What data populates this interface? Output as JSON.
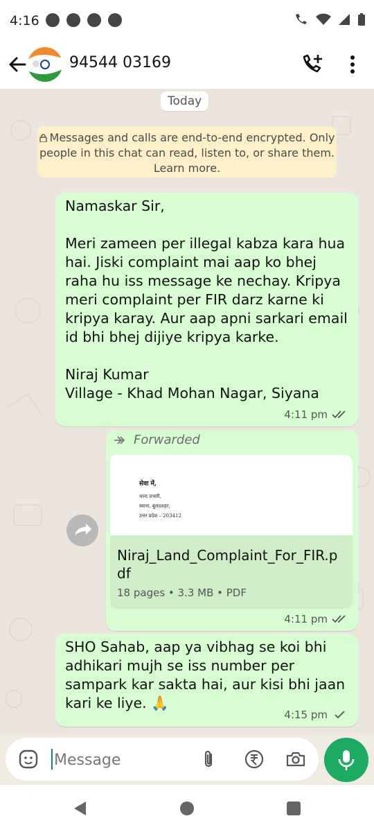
{
  "status": {
    "time": "4:16"
  },
  "header": {
    "contact": "94544 03169"
  },
  "chat": {
    "day_chip": "Today",
    "encryption_notice": "Messages and calls are end-to-end encrypted. Only people in this chat can read, listen to, or share them. Learn more.",
    "messages": [
      {
        "text": "Namaskar Sir,\n\nMeri zameen per illegal kabza kara hua hai. Jiski complaint mai aap ko bhej raha hu iss message ke nechay. Kripya meri complaint per FIR darz karne ki kripya karay. Aur aap apni sarkari email id bhi bhej dijiye kripya karke.\n\nNiraj Kumar\nVillage - Khad Mohan Nagar, Siyana",
        "time": "4:11 pm"
      },
      {
        "forwarded_label": "Forwarded",
        "doc_preview": {
          "heading": "सेवा में,",
          "line1": "थाना प्रभारी,",
          "line2": "स्याना, बुलंदशहर,",
          "line3": "उत्तर प्रदेश – 203412"
        },
        "file_name": "Niraj_Land_Complaint_For_FIR.pdf",
        "file_meta": "18 pages • 3.3 MB • PDF",
        "time": "4:11 pm"
      },
      {
        "text": "SHO Sahab, aap ya vibhag se koi bhi adhikari mujh se iss number per sampark kar sakta hai, aur kisi bhi jaan kari ke liye. 🙏",
        "time": "4:15 pm"
      }
    ]
  },
  "composer": {
    "placeholder": "Message"
  },
  "colors": {
    "accent": "#1daa61",
    "outgoing_bubble": "#d9fdd3",
    "notice_bg": "#fdf0c8"
  },
  "icons": [
    "back-arrow-icon",
    "add-call-icon",
    "more-vert-icon",
    "lock-icon",
    "forward-icon",
    "share-icon",
    "sticker-icon",
    "attach-icon",
    "rupee-icon",
    "camera-icon",
    "mic-icon"
  ]
}
